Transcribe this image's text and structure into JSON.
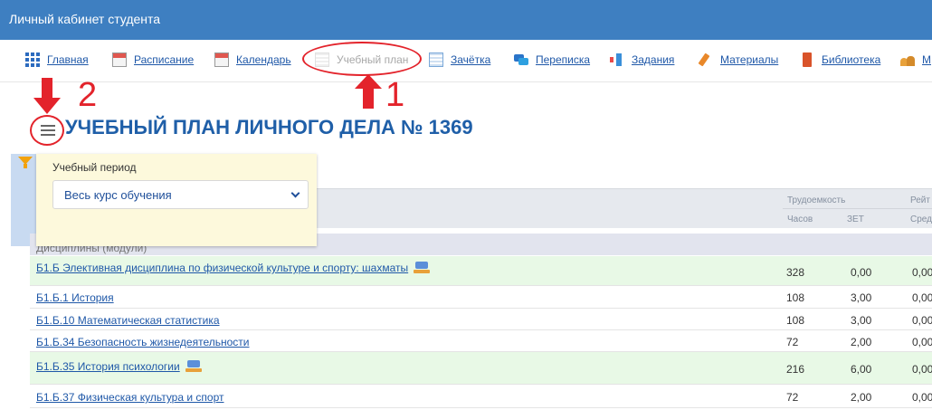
{
  "app": {
    "title": "Личный кабинет студента"
  },
  "nav": {
    "items": [
      {
        "label": "Главная",
        "icon": "grid-icon"
      },
      {
        "label": "Расписание",
        "icon": "calendar-icon"
      },
      {
        "label": "Календарь",
        "icon": "calendar-icon"
      },
      {
        "label": "Учебный план",
        "icon": "plan-icon",
        "active": true
      },
      {
        "label": "Зачётка",
        "icon": "record-book-icon"
      },
      {
        "label": "Переписка",
        "icon": "chat-icon"
      },
      {
        "label": "Задания",
        "icon": "tasks-icon"
      },
      {
        "label": "Материалы",
        "icon": "materials-icon"
      },
      {
        "label": "Библиотека",
        "icon": "library-icon"
      },
      {
        "label": "М",
        "icon": "users-icon"
      }
    ]
  },
  "page": {
    "title": "УЧЕБНЫЙ ПЛАН ЛИЧНОГО ДЕЛА № 1369"
  },
  "filter": {
    "label": "Учебный период",
    "selected": "Весь курс обучения"
  },
  "table": {
    "headers": {
      "labor": "Трудоемкость",
      "rating": "Рейт",
      "hours": "Часов",
      "zet": "ЗЕТ",
      "avg": "Сред"
    },
    "group": "Дисциплины (модули)",
    "rows": [
      {
        "name": "Б1.Б Элективная дисциплина по физической культуре и спорту: шахматы",
        "hours": "328",
        "zet": "0,00",
        "rating": "0,00",
        "highlight": true,
        "has_icon": true
      },
      {
        "name": "Б1.Б.1 История",
        "hours": "108",
        "zet": "3,00",
        "rating": "0,00",
        "highlight": false,
        "has_icon": false
      },
      {
        "name": "Б1.Б.10 Математическая статистика",
        "hours": "108",
        "zet": "3,00",
        "rating": "0,00",
        "highlight": false,
        "has_icon": false
      },
      {
        "name": "Б1.Б.34 Безопасность жизнедеятельности",
        "hours": "72",
        "zet": "2,00",
        "rating": "0,00",
        "highlight": false,
        "has_icon": false
      },
      {
        "name": "Б1.Б.35 История психологии",
        "hours": "216",
        "zet": "6,00",
        "rating": "0,00",
        "highlight": true,
        "has_icon": true
      },
      {
        "name": "Б1.Б.37 Физическая культура и спорт",
        "hours": "72",
        "zet": "2,00",
        "rating": "0,00",
        "highlight": false,
        "has_icon": false
      }
    ]
  },
  "annotations": {
    "marker_1": "1",
    "marker_2": "2"
  },
  "colors": {
    "accent": "#3e7fc1",
    "annotation": "#e3232b",
    "row_highlight": "#e8f9e6",
    "filter_panel": "#fdf9dc"
  }
}
